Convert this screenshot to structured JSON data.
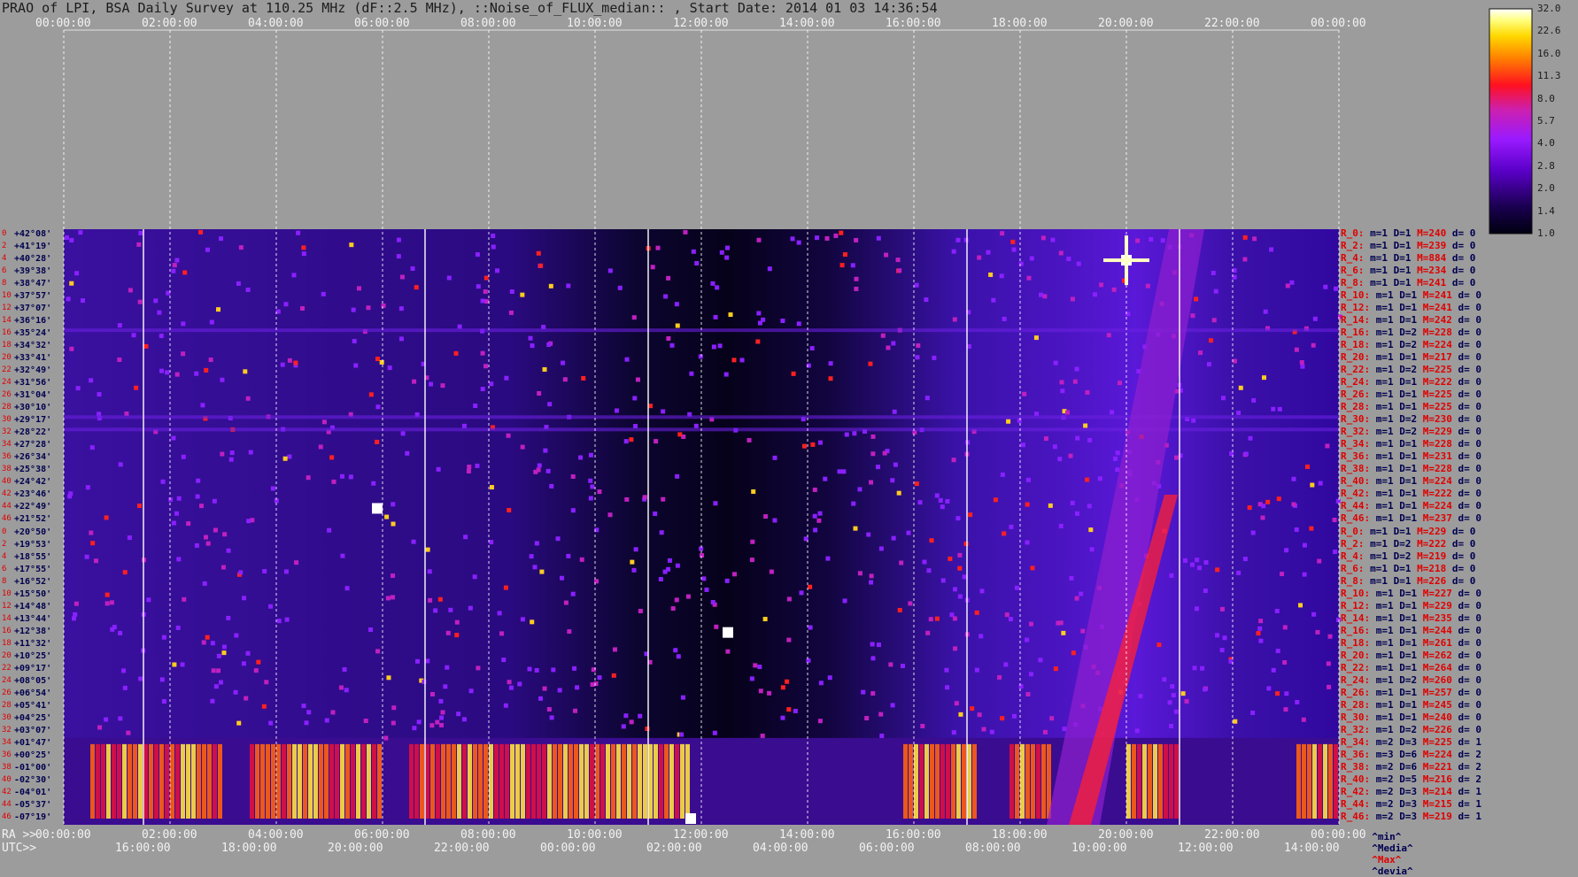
{
  "title": "PRAO of LPI, BSA Daily Survey at 110.25 MHz (dF::2.5 MHz), ::Noise_of_FLUX_median:: , Start Date: 2014 01 03 14:36:54",
  "top_ticks": [
    "00:00:00",
    "02:00:00",
    "04:00:00",
    "06:00:00",
    "08:00:00",
    "10:00:00",
    "12:00:00",
    "14:00:00",
    "16:00:00",
    "18:00:00",
    "20:00:00",
    "22:00:00",
    "00:00:00"
  ],
  "bottom_ra_label": "RA >>",
  "bottom_ra_ticks": [
    "00:00:00",
    "02:00:00",
    "04:00:00",
    "06:00:00",
    "08:00:00",
    "10:00:00",
    "12:00:00",
    "14:00:00",
    "16:00:00",
    "18:00:00",
    "20:00:00",
    "22:00:00",
    "00:00:00"
  ],
  "bottom_utc_label": "UTC>>",
  "bottom_utc_ticks": [
    "16:00:00",
    "18:00:00",
    "20:00:00",
    "22:00:00",
    "00:00:00",
    "02:00:00",
    "04:00:00",
    "06:00:00",
    "08:00:00",
    "10:00:00",
    "12:00:00",
    "14:00:00"
  ],
  "colorbar_ticks": [
    "32.0",
    "22.6",
    "16.0",
    "11.3",
    "8.0",
    "5.7",
    "4.0",
    "2.8",
    "2.0",
    "1.4",
    "1.0"
  ],
  "colors": {
    "background": "#9c9c9c",
    "low": "#000010",
    "mid": "#7a10ff",
    "high": "#ff2000",
    "max": "#ffffff",
    "stat_red": "#e00000",
    "stat_navy": "#000050"
  },
  "legend_footer": {
    "min": "^min^",
    "media": "^Media^",
    "max": "^Max^",
    "devia": "^devia^"
  },
  "dec_labels": [
    "+42°08'",
    "+41°19'",
    "+40°28'",
    "+39°38'",
    "+38°47'",
    "+37°57'",
    "+37°07'",
    "+36°16'",
    "+35°24'",
    "+34°32'",
    "+33°41'",
    "+32°49'",
    "+31°56'",
    "+31°04'",
    "+30°10'",
    "+29°17'",
    "+28°22'",
    "+27°28'",
    "+26°34'",
    "+25°38'",
    "+24°42'",
    "+23°46'",
    "+22°49'",
    "+21°52'",
    "+20°50'",
    "+19°53'",
    "+18°55'",
    "+17°55'",
    "+16°52'",
    "+15°50'",
    "+14°48'",
    "+13°44'",
    "+12°38'",
    "+11°32'",
    "+10°25'",
    "+09°17'",
    "+08°05'",
    "+06°54'",
    "+05°41'",
    "+04°25'",
    "+03°07'",
    "+01°47'",
    "+00°25'",
    "-01°00'",
    "-02°30'",
    "-04°01'",
    "-05°37'",
    "-07°19'"
  ],
  "row_nums": [
    "0",
    "2",
    "4",
    "6",
    "8",
    "10",
    "12",
    "14",
    "16",
    "18",
    "20",
    "22",
    "24",
    "26",
    "28",
    "30",
    "32",
    "34",
    "36",
    "38",
    "40",
    "42",
    "44",
    "46",
    "0",
    "2",
    "4",
    "6",
    "8",
    "10",
    "12",
    "14",
    "16",
    "18",
    "20",
    "22",
    "24",
    "26",
    "28",
    "30",
    "32",
    "34",
    "36",
    "38",
    "40",
    "42",
    "44",
    "46"
  ],
  "stats": [
    {
      "r": "R_0:",
      "m": "m=1",
      "D": "D=1",
      "M": "M=240",
      "d": "d= 0"
    },
    {
      "r": "R_2:",
      "m": "m=1",
      "D": "D=1",
      "M": "M=239",
      "d": "d= 0"
    },
    {
      "r": "R_4:",
      "m": "m=1",
      "D": "D=1",
      "M": "M=884",
      "d": "d= 0"
    },
    {
      "r": "R_6:",
      "m": "m=1",
      "D": "D=1",
      "M": "M=234",
      "d": "d= 0"
    },
    {
      "r": "R_8:",
      "m": "m=1",
      "D": "D=1",
      "M": "M=241",
      "d": "d= 0"
    },
    {
      "r": "R_10:",
      "m": "m=1",
      "D": "D=1",
      "M": "M=241",
      "d": "d= 0"
    },
    {
      "r": "R_12:",
      "m": "m=1",
      "D": "D=1",
      "M": "M=241",
      "d": "d= 0"
    },
    {
      "r": "R_14:",
      "m": "m=1",
      "D": "D=1",
      "M": "M=242",
      "d": "d= 0"
    },
    {
      "r": "R_16:",
      "m": "m=1",
      "D": "D=2",
      "M": "M=228",
      "d": "d= 0"
    },
    {
      "r": "R_18:",
      "m": "m=1",
      "D": "D=2",
      "M": "M=224",
      "d": "d= 0"
    },
    {
      "r": "R_20:",
      "m": "m=1",
      "D": "D=1",
      "M": "M=217",
      "d": "d= 0"
    },
    {
      "r": "R_22:",
      "m": "m=1",
      "D": "D=2",
      "M": "M=225",
      "d": "d= 0"
    },
    {
      "r": "R_24:",
      "m": "m=1",
      "D": "D=1",
      "M": "M=222",
      "d": "d= 0"
    },
    {
      "r": "R_26:",
      "m": "m=1",
      "D": "D=1",
      "M": "M=225",
      "d": "d= 0"
    },
    {
      "r": "R_28:",
      "m": "m=1",
      "D": "D=1",
      "M": "M=225",
      "d": "d= 0"
    },
    {
      "r": "R_30:",
      "m": "m=1",
      "D": "D=2",
      "M": "M=230",
      "d": "d= 0"
    },
    {
      "r": "R_32:",
      "m": "m=1",
      "D": "D=2",
      "M": "M=229",
      "d": "d= 0"
    },
    {
      "r": "R_34:",
      "m": "m=1",
      "D": "D=1",
      "M": "M=228",
      "d": "d= 0"
    },
    {
      "r": "R_36:",
      "m": "m=1",
      "D": "D=1",
      "M": "M=231",
      "d": "d= 0"
    },
    {
      "r": "R_38:",
      "m": "m=1",
      "D": "D=1",
      "M": "M=228",
      "d": "d= 0"
    },
    {
      "r": "R_40:",
      "m": "m=1",
      "D": "D=1",
      "M": "M=224",
      "d": "d= 0"
    },
    {
      "r": "R_42:",
      "m": "m=1",
      "D": "D=1",
      "M": "M=222",
      "d": "d= 0"
    },
    {
      "r": "R_44:",
      "m": "m=1",
      "D": "D=1",
      "M": "M=224",
      "d": "d= 0"
    },
    {
      "r": "R_46:",
      "m": "m=1",
      "D": "D=1",
      "M": "M=237",
      "d": "d= 0"
    },
    {
      "r": "R_0:",
      "m": "m=1",
      "D": "D=1",
      "M": "M=229",
      "d": "d= 0"
    },
    {
      "r": "R_2:",
      "m": "m=1",
      "D": "D=2",
      "M": "M=222",
      "d": "d= 0"
    },
    {
      "r": "R_4:",
      "m": "m=1",
      "D": "D=2",
      "M": "M=219",
      "d": "d= 0"
    },
    {
      "r": "R_6:",
      "m": "m=1",
      "D": "D=1",
      "M": "M=218",
      "d": "d= 0"
    },
    {
      "r": "R_8:",
      "m": "m=1",
      "D": "D=1",
      "M": "M=226",
      "d": "d= 0"
    },
    {
      "r": "R_10:",
      "m": "m=1",
      "D": "D=1",
      "M": "M=227",
      "d": "d= 0"
    },
    {
      "r": "R_12:",
      "m": "m=1",
      "D": "D=1",
      "M": "M=229",
      "d": "d= 0"
    },
    {
      "r": "R_14:",
      "m": "m=1",
      "D": "D=1",
      "M": "M=235",
      "d": "d= 0"
    },
    {
      "r": "R_16:",
      "m": "m=1",
      "D": "D=1",
      "M": "M=244",
      "d": "d= 0"
    },
    {
      "r": "R_18:",
      "m": "m=1",
      "D": "D=1",
      "M": "M=261",
      "d": "d= 0"
    },
    {
      "r": "R_20:",
      "m": "m=1",
      "D": "D=1",
      "M": "M=262",
      "d": "d= 0"
    },
    {
      "r": "R_22:",
      "m": "m=1",
      "D": "D=1",
      "M": "M=264",
      "d": "d= 0"
    },
    {
      "r": "R_24:",
      "m": "m=1",
      "D": "D=2",
      "M": "M=260",
      "d": "d= 0"
    },
    {
      "r": "R_26:",
      "m": "m=1",
      "D": "D=1",
      "M": "M=257",
      "d": "d= 0"
    },
    {
      "r": "R_28:",
      "m": "m=1",
      "D": "D=1",
      "M": "M=245",
      "d": "d= 0"
    },
    {
      "r": "R_30:",
      "m": "m=1",
      "D": "D=1",
      "M": "M=240",
      "d": "d= 0"
    },
    {
      "r": "R_32:",
      "m": "m=1",
      "D": "D=2",
      "M": "M=226",
      "d": "d= 0"
    },
    {
      "r": "R_34:",
      "m": "m=2",
      "D": "D=3",
      "M": "M=225",
      "d": "d= 1"
    },
    {
      "r": "R_36:",
      "m": "m=3",
      "D": "D=6",
      "M": "M=224",
      "d": "d= 2"
    },
    {
      "r": "R_38:",
      "m": "m=2",
      "D": "D=6",
      "M": "M=221",
      "d": "d= 2"
    },
    {
      "r": "R_40:",
      "m": "m=2",
      "D": "D=5",
      "M": "M=216",
      "d": "d= 2"
    },
    {
      "r": "R_42:",
      "m": "m=2",
      "D": "D=3",
      "M": "M=214",
      "d": "d= 1"
    },
    {
      "r": "R_44:",
      "m": "m=2",
      "D": "D=3",
      "M": "M=215",
      "d": "d= 1"
    },
    {
      "r": "R_46:",
      "m": "m=2",
      "D": "D=3",
      "M": "M=219",
      "d": "d= 1"
    }
  ],
  "chart_data": {
    "type": "heatmap",
    "title": "PRAO of LPI, BSA Daily Survey at 110.25 MHz (dF::2.5 MHz), ::Noise_of_FLUX_median:: , Start Date: 2014 01 03 14:36:54",
    "x_axis_top": "RA 00:00:00 to 00:00:00",
    "x_range_hours": [
      0,
      24
    ],
    "color_scale": "log",
    "color_range": [
      1.0,
      32.0
    ],
    "rows": 48,
    "hot_band_rows": [
      "+01°47'",
      "-07°19'"
    ],
    "hot_regions_ra_hours": [
      [
        0.5,
        3.0
      ],
      [
        3.5,
        6.0
      ],
      [
        6.5,
        11.8
      ],
      [
        15.8,
        17.2
      ],
      [
        17.8,
        18.6
      ],
      [
        20.0,
        21.0
      ],
      [
        23.2,
        24.0
      ]
    ],
    "diagonal_feature_ra_hours": [
      19.0,
      20.8
    ],
    "bright_sources": [
      {
        "ra_hours": 20.0,
        "dec": "+40°28'"
      },
      {
        "ra_hours": 5.9,
        "dec": "+22°49'"
      },
      {
        "ra_hours": 12.5,
        "dec": "+12°38'"
      },
      {
        "ra_hours": 11.8,
        "dec": "-07°19'"
      }
    ]
  }
}
